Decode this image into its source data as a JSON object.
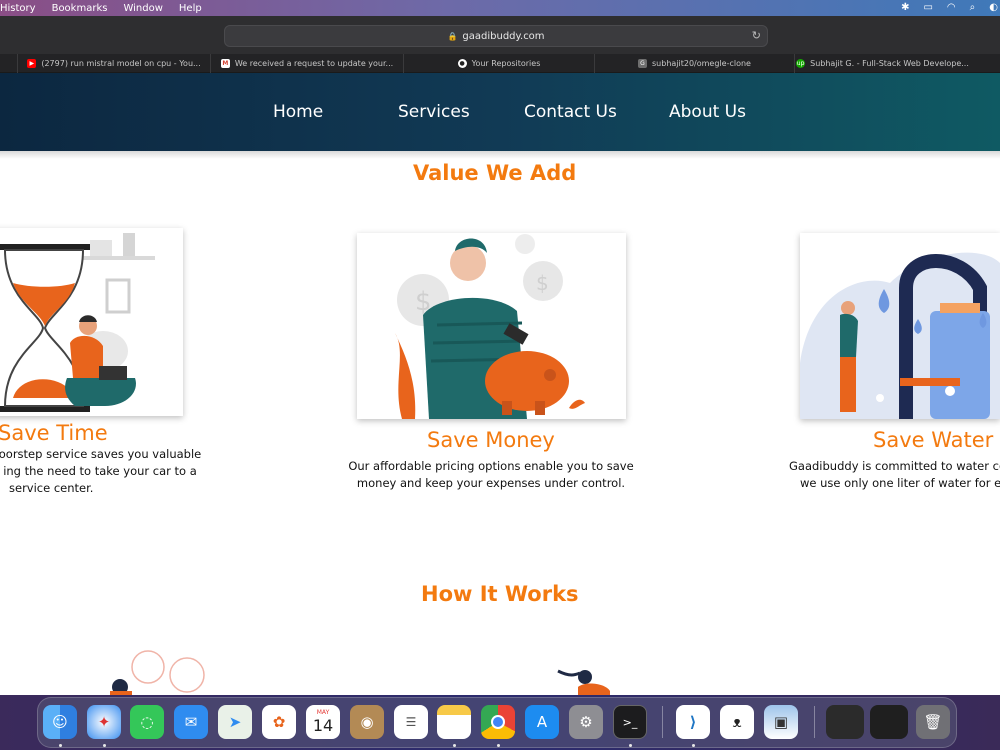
{
  "menubar": {
    "items": [
      "History",
      "Bookmarks",
      "Window",
      "Help"
    ],
    "status": {
      "bluetooth": "✱",
      "battery": "▭",
      "wifi": "◠",
      "search": "⌕",
      "user": "◐"
    }
  },
  "browser": {
    "url": "gaadibuddy.com",
    "tabs": [
      {
        "label": "(2797) run mistral model on cpu - You...",
        "icon": "youtube-icon",
        "color": "#ff0000"
      },
      {
        "label": "We received a request to update your...",
        "icon": "gmail-icon",
        "color": "#d44638"
      },
      {
        "label": "Your Repositories",
        "icon": "github-icon",
        "color": "#ffffff"
      },
      {
        "label": "subhajit20/omegle-clone",
        "icon": "g-icon",
        "color": "#6e6e6e"
      },
      {
        "label": "Subhajit G. - Full-Stack Web Develope...",
        "icon": "upwork-icon",
        "color": "#14a800"
      }
    ]
  },
  "nav": {
    "home": "Home",
    "services": "Services",
    "contact": "Contact Us",
    "about": "About Us"
  },
  "value_section": {
    "title": "Value We Add",
    "cards": [
      {
        "title": "Save Time",
        "desc_lines": [
          "oorstep service saves you valuable",
          "ing the need to take your car to a",
          "service center."
        ]
      },
      {
        "title": "Save Money",
        "desc_lines": [
          "Our affordable pricing options enable you to save",
          "money and keep your expenses under control."
        ]
      },
      {
        "title": "Save Water",
        "desc_lines": [
          "Gaadibuddy is committed to water co",
          "we use only one liter of water for ea"
        ]
      }
    ]
  },
  "how_section": {
    "title": "How It Works"
  },
  "dock": {
    "calendar_month": "MAY",
    "calendar_day": "14"
  },
  "colors": {
    "accent": "#f37a0f",
    "nav_start": "#0c2740",
    "nav_end": "#0f5a63"
  }
}
